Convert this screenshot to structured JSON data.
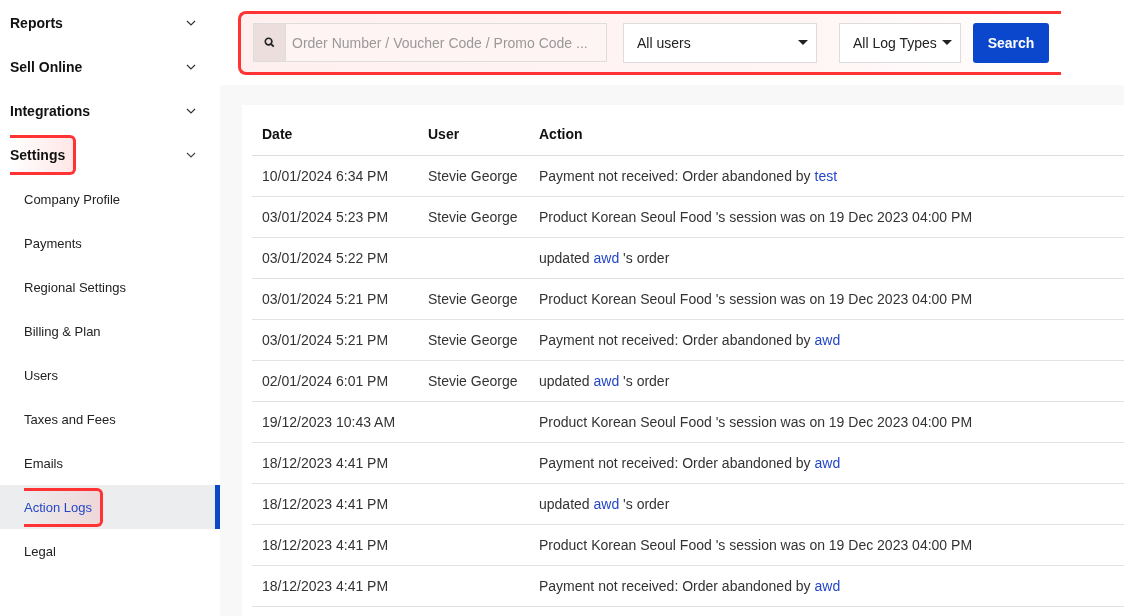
{
  "sidebar": {
    "sections": [
      {
        "label": "Reports",
        "expanded": false,
        "highlighted": false
      },
      {
        "label": "Sell Online",
        "expanded": false,
        "highlighted": false
      },
      {
        "label": "Integrations",
        "expanded": false,
        "highlighted": false
      },
      {
        "label": "Settings",
        "expanded": true,
        "highlighted": true,
        "children": [
          {
            "label": "Company Profile",
            "selected": false,
            "highlighted": false
          },
          {
            "label": "Payments",
            "selected": false,
            "highlighted": false
          },
          {
            "label": "Regional Settings",
            "selected": false,
            "highlighted": false
          },
          {
            "label": "Billing & Plan",
            "selected": false,
            "highlighted": false
          },
          {
            "label": "Users",
            "selected": false,
            "highlighted": false
          },
          {
            "label": "Taxes and Fees",
            "selected": false,
            "highlighted": false
          },
          {
            "label": "Emails",
            "selected": false,
            "highlighted": false
          },
          {
            "label": "Action Logs",
            "selected": true,
            "highlighted": true
          },
          {
            "label": "Legal",
            "selected": false,
            "highlighted": false
          }
        ]
      }
    ]
  },
  "filters": {
    "highlighted": true,
    "search": {
      "placeholder": "Order Number / Voucher Code / Promo Code ..."
    },
    "user_select": "All users",
    "type_select": "All Log Types",
    "button": "Search"
  },
  "table": {
    "columns": [
      "Date",
      "User",
      "Action"
    ],
    "rows": [
      {
        "date": "10/01/2024 6:34 PM",
        "user": "Stevie George",
        "action": {
          "before": "Payment not received: Order abandoned by ",
          "link": "test"
        }
      },
      {
        "date": "03/01/2024 5:23 PM",
        "user": "Stevie George",
        "action": {
          "before": "Product Korean Seoul Food 's session was on 19 Dec 2023 04:00 PM"
        }
      },
      {
        "date": "03/01/2024 5:22 PM",
        "action": {
          "before": "updated ",
          "link": "awd",
          "after": " 's order"
        }
      },
      {
        "date": "03/01/2024 5:21 PM",
        "user": "Stevie George",
        "action": {
          "before": "Product Korean Seoul Food 's session was on 19 Dec 2023 04:00 PM"
        }
      },
      {
        "date": "03/01/2024 5:21 PM",
        "user": "Stevie George",
        "action": {
          "before": "Payment not received: Order abandoned by ",
          "link": "awd"
        }
      },
      {
        "date": "02/01/2024 6:01 PM",
        "user": "Stevie George",
        "action": {
          "before": "updated ",
          "link": "awd",
          "after": " 's order"
        }
      },
      {
        "date": "19/12/2023 10:43 AM",
        "action": {
          "before": "Product Korean Seoul Food 's session was on 19 Dec 2023 04:00 PM"
        }
      },
      {
        "date": "18/12/2023 4:41 PM",
        "action": {
          "before": "Payment not received: Order abandoned by ",
          "link": "awd"
        }
      },
      {
        "date": "18/12/2023 4:41 PM",
        "action": {
          "before": "updated ",
          "link": "awd",
          "after": " 's order"
        }
      },
      {
        "date": "18/12/2023 4:41 PM",
        "action": {
          "before": "Product Korean Seoul Food 's session was on 19 Dec 2023 04:00 PM"
        }
      },
      {
        "date": "18/12/2023 4:41 PM",
        "action": {
          "before": "Payment not received: Order abandoned by ",
          "link": "awd"
        }
      }
    ]
  }
}
